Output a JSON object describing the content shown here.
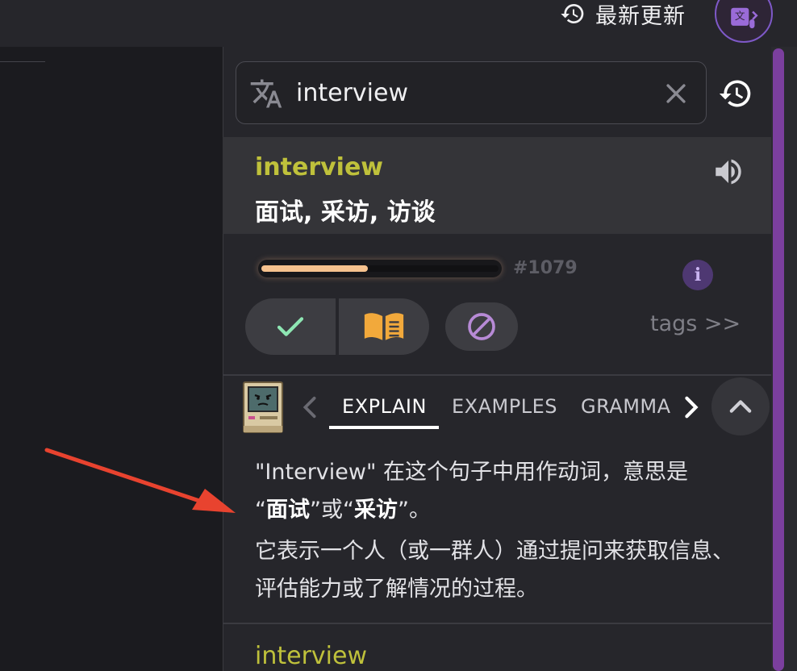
{
  "topbar": {
    "recent_updates_label": "最新更新",
    "recent_icon": "history-icon",
    "app_icon": "translate-mic-icon"
  },
  "search": {
    "value": "interview",
    "icon": "translate-icon",
    "clear_icon": "close-icon"
  },
  "history_icon": "history-icon",
  "entry": {
    "word": "interview",
    "meaning": "面试, 采访, 访谈",
    "speaker_icon": "speaker-icon",
    "progress": 0.45,
    "rank": "#1079",
    "info_label": "i"
  },
  "actions": {
    "known_icon": "check-icon",
    "learn_icon": "book-icon",
    "ignore_icon": "ban-icon",
    "tags_label": "tags >>"
  },
  "tabs": {
    "items": [
      "EXPLAIN",
      "EXAMPLES",
      "GRAMMA"
    ],
    "active": "EXPLAIN"
  },
  "explain": {
    "p1_a": "\"Interview\" 在这个句子中用作动词，意思是",
    "p1_q1": "“",
    "p1_b1": "面试",
    "p1_mid": "”或“",
    "p1_b2": "采访",
    "p1_end": "”。",
    "p2": "它表示一个人（或一群人）通过提问来获取信息、评估能力或了解情况的过程。"
  },
  "next_entry_word": "interview",
  "colors": {
    "accent_word": "#bfc13b",
    "progress_fill": "#f6c28e",
    "check": "#8ee6b3",
    "book": "#f2a93b",
    "ignore": "#b78ad6",
    "scrollbar": "#7b3f9e",
    "arrow": "#e8432f"
  }
}
